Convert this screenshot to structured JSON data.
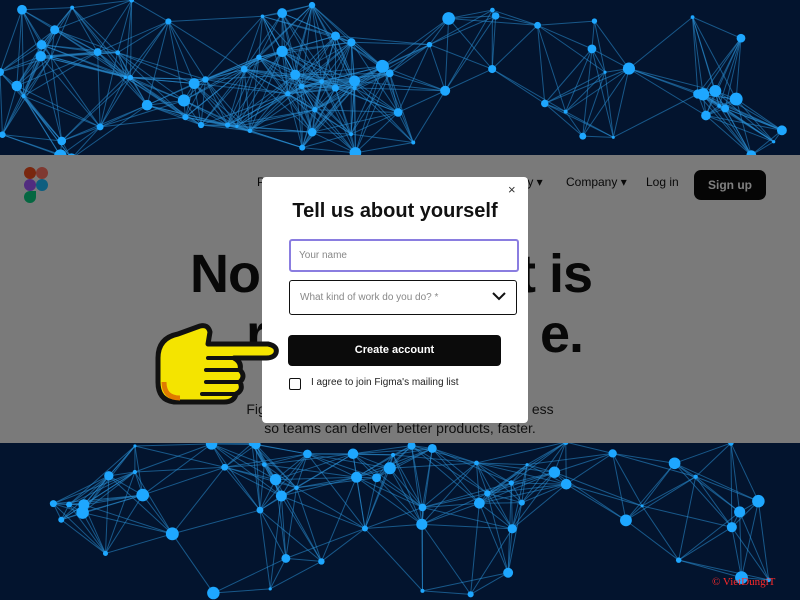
{
  "nav": {
    "partial_left": "P",
    "partial_mid": "ty ▾",
    "company": "Company ▾",
    "login": "Log in",
    "signup": "Sign up"
  },
  "hero": {
    "line1_left": "No",
    "line1_right": "t is",
    "line2_left": "r",
    "line2_right": "e.",
    "sub1_left": "Fig",
    "sub1_right": "ess",
    "sub2": "so teams can deliver better products, faster."
  },
  "modal": {
    "close_glyph": "×",
    "title": "Tell us about yourself",
    "name_placeholder": "Your name",
    "work_placeholder": "What kind of work do you do? *",
    "create_button": "Create account",
    "mailing_label": "I agree to join Figma's mailing list"
  },
  "watermark": "© VietDungiT",
  "colors": {
    "background_network": "#0b3b6a",
    "node": "#1ea7ff",
    "input_focus": "#8a7de0",
    "pointer_hand": "#f4e400"
  },
  "icons": [
    "figma-logo-icon",
    "close-icon",
    "chevron-down-icon",
    "pointing-hand-icon"
  ]
}
